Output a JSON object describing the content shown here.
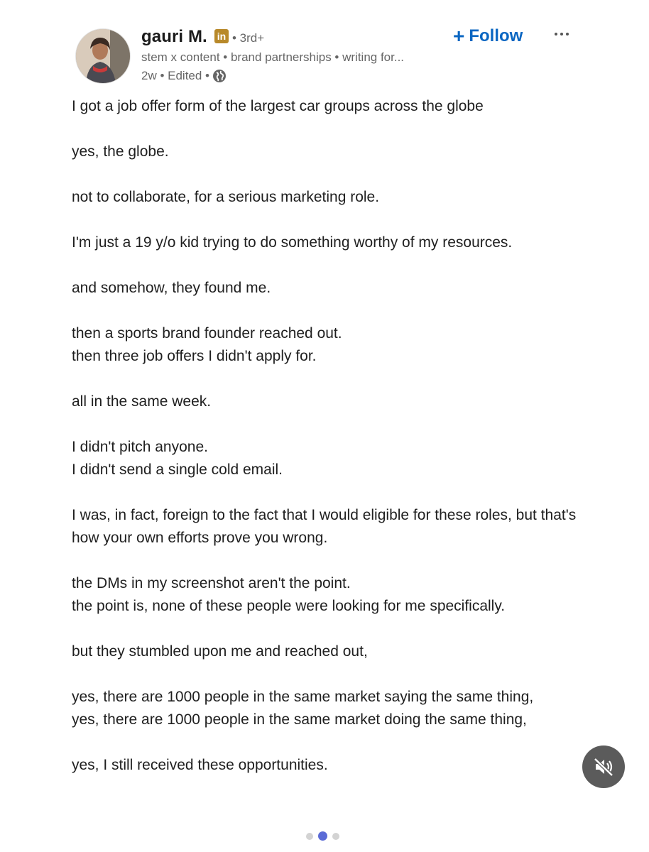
{
  "author": {
    "name": "gauri M.",
    "badge": "in",
    "degree": "• 3rd+",
    "headline": "stem x content • brand partnerships • writing for...",
    "timestamp": "2w • Edited •"
  },
  "actions": {
    "follow_label": "Follow",
    "follow_plus": "+"
  },
  "post": {
    "paragraphs": [
      "I got a job offer form of the largest car groups across the globe",
      "yes, the globe.",
      "not to collaborate, for a serious marketing role.",
      "I'm just a 19 y/o kid trying to do something worthy of my resources.",
      "and somehow, they found me.",
      "then a sports brand founder reached out.\nthen three job offers I didn't apply for.",
      "all in the same week.",
      "I didn't pitch anyone.\nI didn't send a single cold email.",
      "I was, in fact, foreign to the fact that I would eligible for these roles, but that's how your own efforts prove you wrong.",
      "the DMs in my screenshot aren't the point.\nthe point is, none of these people were looking for me specifically.",
      "but they stumbled upon me and reached out,",
      "yes, there are 1000 people in the same market saying the same thing,\nyes, there are 1000 people in the same market doing the same thing,",
      "yes, I still received these opportunities."
    ]
  },
  "carousel": {
    "total_pages": 3,
    "current_page": 2
  },
  "colors": {
    "follow": "#0a66c2",
    "badge": "#b8892a",
    "active_dot": "#5b6bd6",
    "mute_bg": "#5b5b5b"
  },
  "icons": {
    "visibility": "globe-icon",
    "mute": "speaker-muted-icon",
    "more": "ellipsis-icon"
  }
}
